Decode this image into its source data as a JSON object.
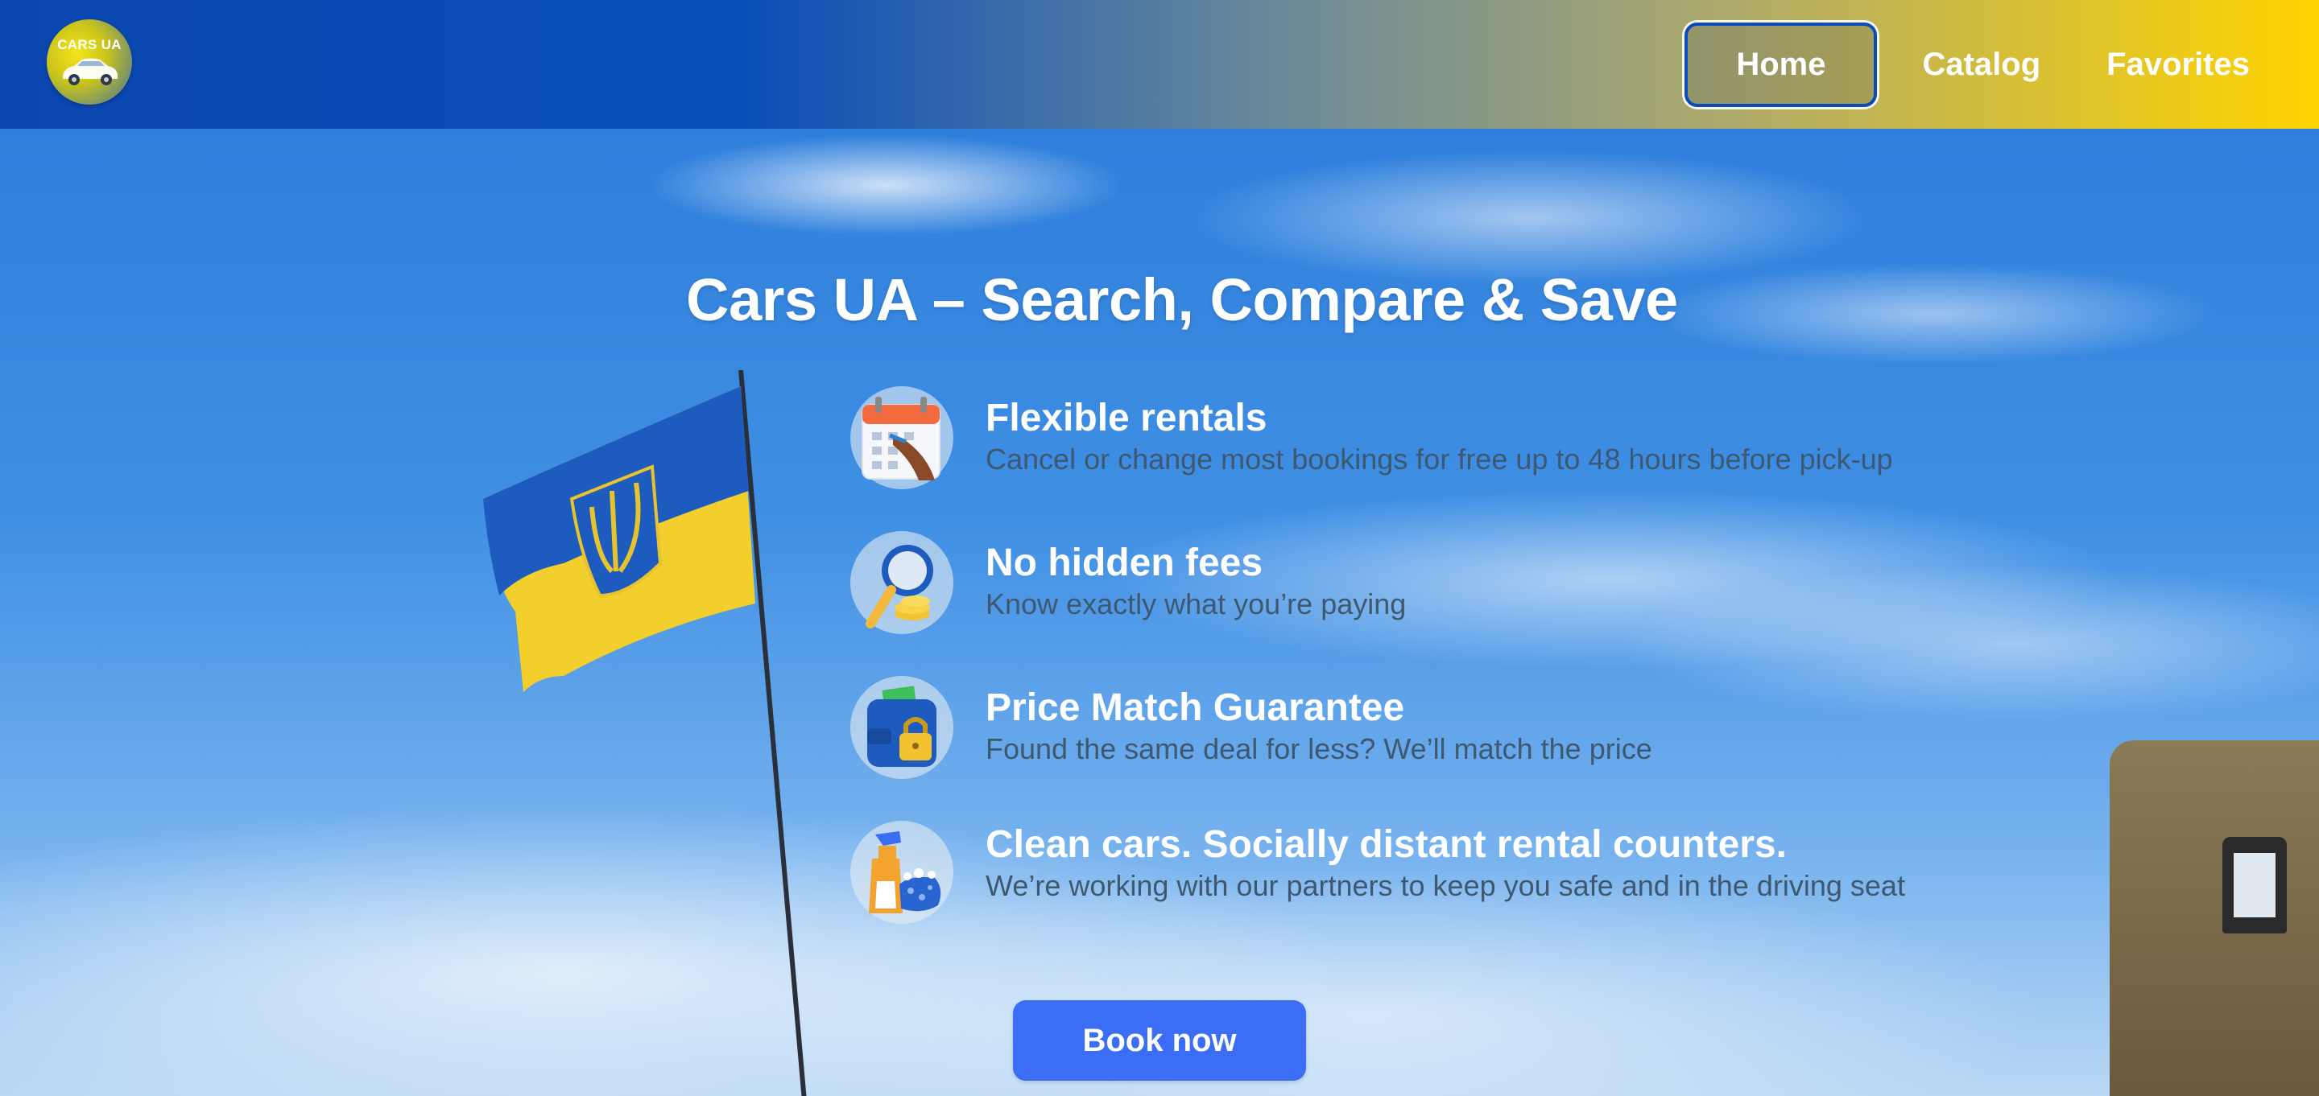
{
  "logo": {
    "text": "CARS UA",
    "icon": "car-icon"
  },
  "nav": {
    "items": [
      {
        "label": "Home",
        "active": true
      },
      {
        "label": "Catalog",
        "active": false
      },
      {
        "label": "Favorites",
        "active": false
      }
    ]
  },
  "hero": {
    "title": "Cars UA – Search, Compare & Save",
    "features": [
      {
        "icon": "calendar-icon",
        "title": "Flexible rentals",
        "description": "Cancel or change most bookings for free up to 48 hours before pick-up"
      },
      {
        "icon": "magnifier-coins-icon",
        "title": "No hidden fees",
        "description": "Know exactly what you’re paying"
      },
      {
        "icon": "wallet-lock-icon",
        "title": "Price Match Guarantee",
        "description": "Found the same deal for less? We’ll match the price"
      },
      {
        "icon": "cleaning-spray-icon",
        "title": "Clean cars. Socially distant rental counters.",
        "description": "We’re working with our partners to keep you safe and in the driving seat"
      }
    ],
    "cta_label": "Book now"
  },
  "colors": {
    "header_start": "#0a4db8",
    "header_end": "#ffd400",
    "button": "#3b6ef5",
    "flag_blue": "#1d5bbf",
    "flag_yellow": "#f2cf2c"
  }
}
